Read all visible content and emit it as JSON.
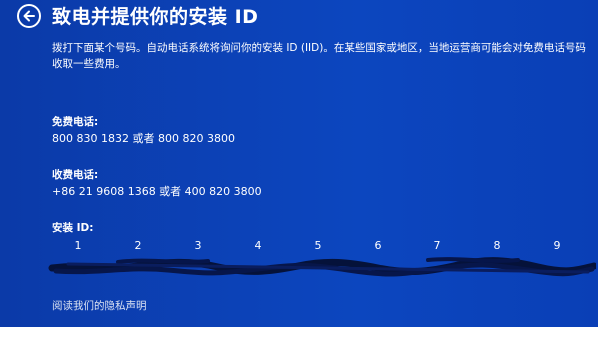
{
  "header": {
    "title": "致电并提供你的安装 ID",
    "back_icon": "arrow-left-circle-icon"
  },
  "description": "拨打下面某个号码。自动电话系统将询问你的安装 ID (IID)。在某些国家或地区，当地运营商可能会对免费电话号码收取一些费用。",
  "toll_free": {
    "label": "免费电话:",
    "value": "800 830 1832 或者 800 820 3800"
  },
  "toll": {
    "label": "收费电话:",
    "value": "+86 21 9608 1368 或者 400 820 3800"
  },
  "installation_id": {
    "label": "安装 ID:",
    "columns": [
      "1",
      "2",
      "3",
      "4",
      "5",
      "6",
      "7",
      "8",
      "9"
    ],
    "redacted": true
  },
  "privacy_link": "阅读我们的隐私声明",
  "colors": {
    "background": "#0c46bf",
    "text": "#ffffff"
  }
}
